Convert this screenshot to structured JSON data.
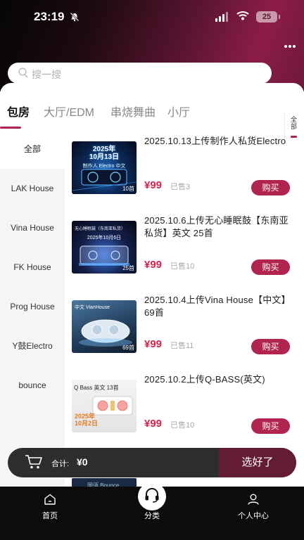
{
  "status_bar": {
    "time": "23:19",
    "battery": "25"
  },
  "search": {
    "placeholder": "搜一搜"
  },
  "tabs": [
    {
      "label": "包房",
      "active": true
    },
    {
      "label": "大厅/EDM",
      "active": false
    },
    {
      "label": "串烧舞曲",
      "active": false
    },
    {
      "label": "小厅",
      "active": false
    }
  ],
  "tab_all_label": "全部",
  "sidebar": {
    "items": [
      {
        "label": "全部",
        "active": true
      },
      {
        "label": "LAK House"
      },
      {
        "label": "Vina House"
      },
      {
        "label": "FK House"
      },
      {
        "label": "Prog House"
      },
      {
        "label": "Y鼓Electro"
      },
      {
        "label": "bounce"
      }
    ]
  },
  "products": [
    {
      "title": "2025.10.13上传制作人私货Electro",
      "price": "¥99",
      "sold": "已售3",
      "buy_label": "购买",
      "thumb_text": "2025年\n10月13日",
      "thumb_sub": "制作人 Electro 中文",
      "badge": "10首"
    },
    {
      "title": "2025.10.6上传无心睡眠鼓【东南亚私货】英文 25首",
      "price": "¥99",
      "sold": "已售10",
      "buy_label": "购买",
      "thumb_text": "2025年10月6日",
      "thumb_sub": "无心睡眠鼓（东南亚私货）",
      "badge": "25首"
    },
    {
      "title": "2025.10.4上传Vina House【中文】69首",
      "price": "¥99",
      "sold": "已售11",
      "buy_label": "购买",
      "thumb_text": "中文 VianHouse",
      "thumb_sub": "",
      "badge": "69首"
    },
    {
      "title": "2025.10.2上传Q-BASS(英文)",
      "price": "¥99",
      "sold": "已售10",
      "buy_label": "购买",
      "thumb_text": "Q Bass 英文 13首",
      "thumb_sub": "2025年\n10月2日",
      "badge": ""
    }
  ],
  "peek_text": "国语 Bounce",
  "cart": {
    "total_label": "合计:",
    "total_value": "¥0",
    "confirm_label": "选好了"
  },
  "bottom_nav": [
    {
      "label": "首页",
      "icon": "home-icon"
    },
    {
      "label": "分类",
      "icon": "headset-icon"
    },
    {
      "label": "个人中心",
      "icon": "user-icon"
    }
  ],
  "colors": {
    "accent": "#b0244f",
    "price": "#d4234c",
    "cart_bg": "#2d2d2d",
    "confirm_bg": "#641c34"
  }
}
